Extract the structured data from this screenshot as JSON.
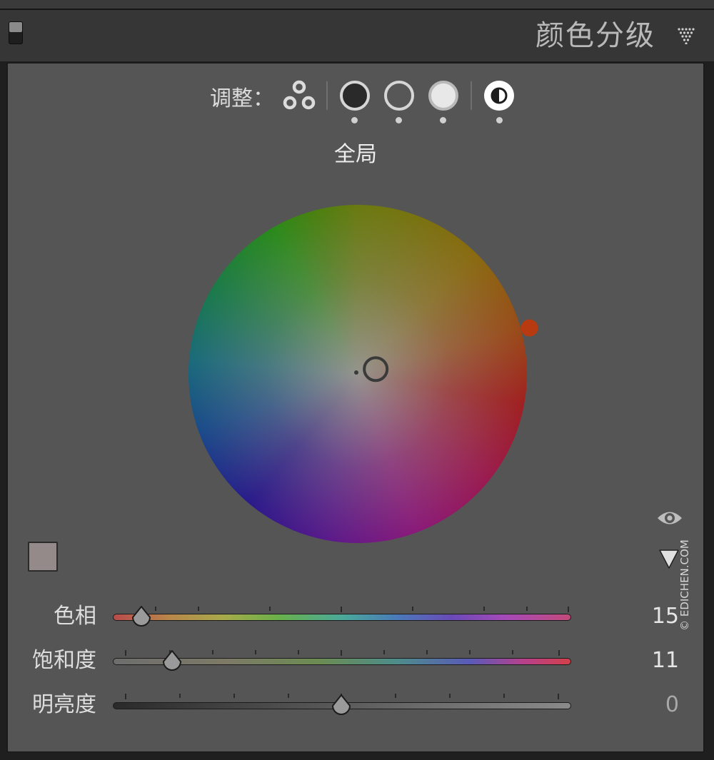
{
  "panel": {
    "title": "颜色分级"
  },
  "adjust": {
    "label": "调整：",
    "modes": [
      {
        "name": "three-way"
      },
      {
        "name": "shadows"
      },
      {
        "name": "midtones"
      },
      {
        "name": "highlights"
      },
      {
        "name": "global",
        "selected": true
      }
    ]
  },
  "wheel": {
    "region_label": "全局",
    "hue": 15,
    "saturation": 11,
    "swatch_color": "#958a8a"
  },
  "sliders": [
    {
      "label": "色相",
      "value": "15",
      "fraction": 0.0625
    },
    {
      "label": "饱和度",
      "value": "11",
      "fraction": 0.13
    },
    {
      "label": "明亮度",
      "value": "0",
      "fraction": 0.5
    }
  ],
  "colors": {
    "hue_marker": "#b83a10",
    "value_active": "#e6e6e6",
    "value_inactive": "#a8a8a8"
  },
  "watermark": "© EDICHEN.COM"
}
